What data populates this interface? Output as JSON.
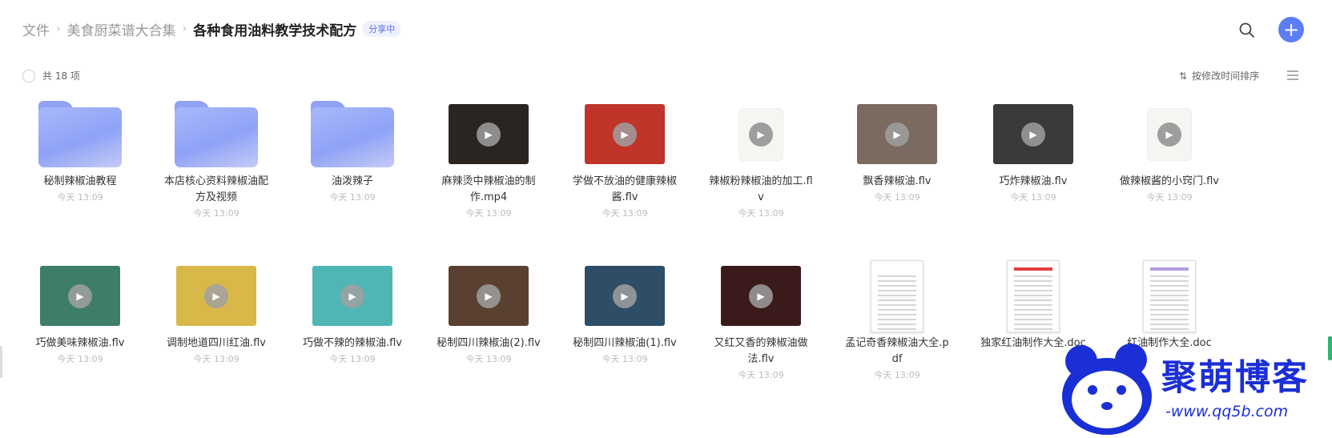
{
  "breadcrumb": {
    "items": [
      "文件",
      "美食厨菜谱大合集"
    ],
    "current": "各种食用油料教学技术配方",
    "badge": "分享中"
  },
  "toolbar": {
    "count_label": "共 18 项",
    "sort_label": "按修改时间排序"
  },
  "icons": {
    "search": "search-icon",
    "add": "plus-icon",
    "list_view": "list-view-icon",
    "sort": "sort-icon"
  },
  "colors": {
    "accent": "#5b7ef5",
    "folder": "#8fa2f4",
    "badge_text": "#5a6cf0"
  },
  "files": [
    {
      "name": "秘制辣椒油教程",
      "date": "今天 13:09",
      "kind": "folder"
    },
    {
      "name": "本店核心资料辣椒油配方及视频",
      "date": "今天 13:09",
      "kind": "folder"
    },
    {
      "name": "油泼辣子",
      "date": "今天 13:09",
      "kind": "folder"
    },
    {
      "name": "麻辣烫中辣椒油的制作.mp4",
      "date": "今天 13:09",
      "kind": "video",
      "bg": "#2a2520"
    },
    {
      "name": "学做不放油的健康辣椒酱.flv",
      "date": "今天 13:09",
      "kind": "video",
      "bg": "#c0342a"
    },
    {
      "name": "辣椒粉辣椒油的加工.flv",
      "date": "今天 13:09",
      "kind": "video-blank"
    },
    {
      "name": "飘香辣椒油.flv",
      "date": "今天 13:09",
      "kind": "video",
      "bg": "#7a6a60"
    },
    {
      "name": "巧炸辣椒油.flv",
      "date": "今天 13:09",
      "kind": "video",
      "bg": "#3a3a3a"
    },
    {
      "name": "做辣椒酱的小窍门.flv",
      "date": "今天 13:09",
      "kind": "video-blank"
    },
    {
      "name": "巧做美味辣椒油.flv",
      "date": "今天 13:09",
      "kind": "video",
      "bg": "#3d7d6a"
    },
    {
      "name": "调制地道四川红油.flv",
      "date": "今天 13:09",
      "kind": "video",
      "bg": "#d9b84a"
    },
    {
      "name": "巧做不辣的辣椒油.flv",
      "date": "今天 13:09",
      "kind": "video",
      "bg": "#4fb5b5"
    },
    {
      "name": "秘制四川辣椒油(2).flv",
      "date": "今天 13:09",
      "kind": "video",
      "bg": "#5a4030"
    },
    {
      "name": "秘制四川辣椒油(1).flv",
      "date": "今天 13:09",
      "kind": "video",
      "bg": "#2e4d66"
    },
    {
      "name": "又红又香的辣椒油做法.flv",
      "date": "今天 13:09",
      "kind": "video",
      "bg": "#3a1a1a"
    },
    {
      "name": "孟记奇香辣椒油大全.pdf",
      "date": "今天 13:09",
      "kind": "doc"
    },
    {
      "name": "独家红油制作大全.doc",
      "date": "",
      "kind": "doc-red"
    },
    {
      "name": "红油制作大全.doc",
      "date": "",
      "kind": "doc-purple"
    }
  ],
  "watermark": {
    "text": "聚萌博客",
    "url": "-www.qq5b.com"
  }
}
